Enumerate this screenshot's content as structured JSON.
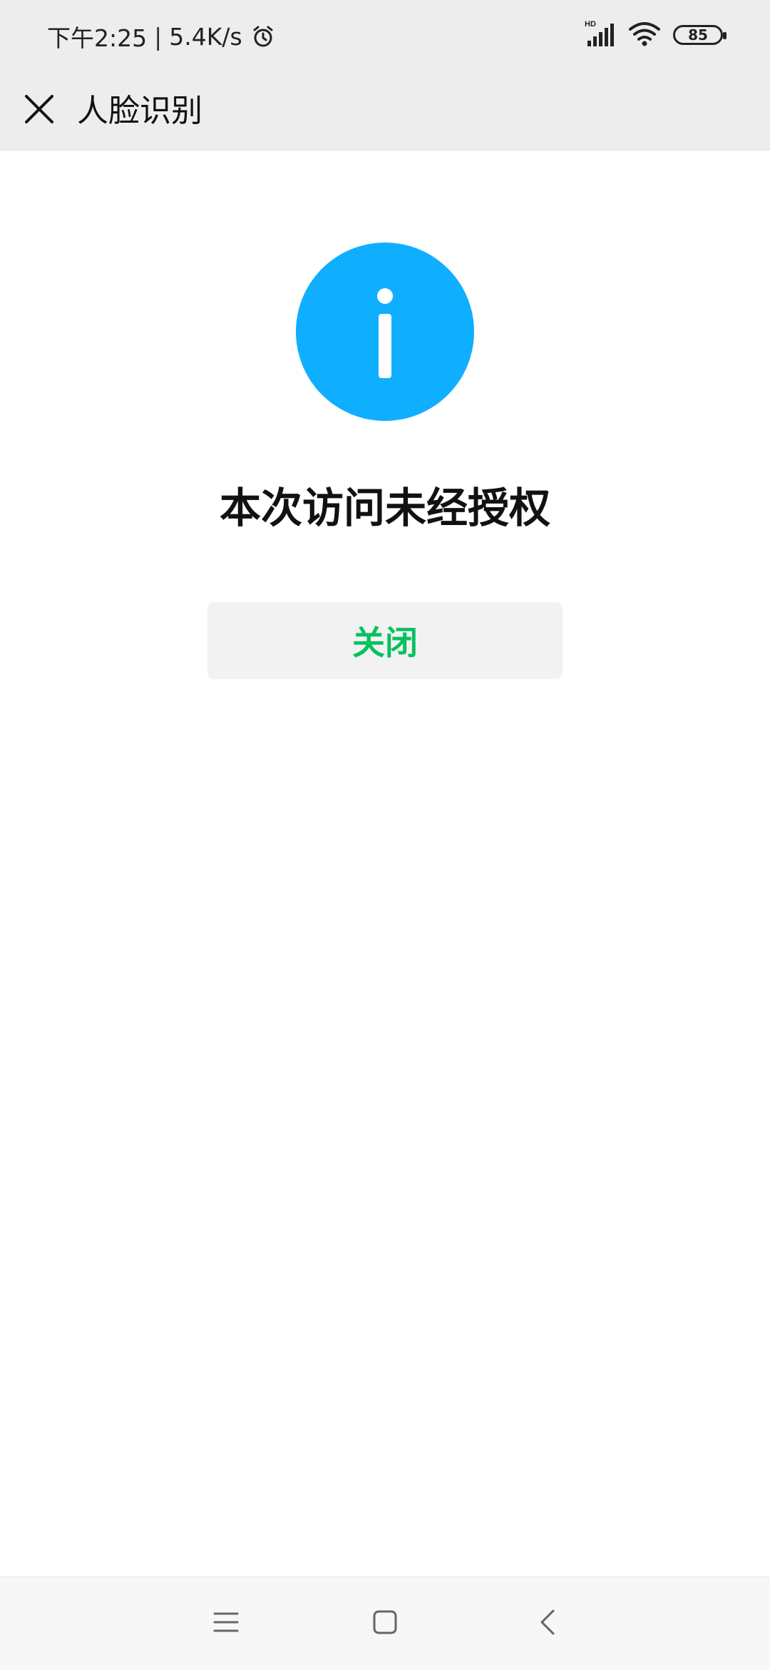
{
  "status_bar": {
    "time": "下午2:25",
    "separator": "|",
    "network_speed": "5.4K/s",
    "alarm_icon": "alarm-clock-icon",
    "signal_icon": "hd-signal-icon",
    "wifi_icon": "wifi-icon",
    "battery_level": "85"
  },
  "header": {
    "close_icon": "close-icon",
    "title": "人脸识别"
  },
  "main": {
    "icon": "info-icon",
    "icon_color": "#10aeff",
    "message": "本次访问未经授权",
    "close_button_label": "关闭",
    "close_button_color": "#07c160"
  },
  "nav_bar": {
    "menu_icon": "menu-icon",
    "home_icon": "home-icon",
    "back_icon": "back-icon"
  }
}
